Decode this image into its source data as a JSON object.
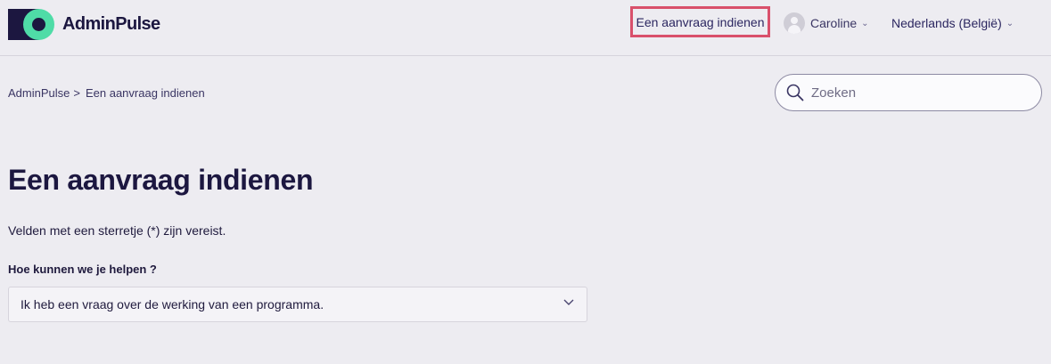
{
  "header": {
    "brand": "AdminPulse",
    "submit_request_link": "Een aanvraag indienen",
    "user_name": "Caroline",
    "language": "Nederlands (België)"
  },
  "breadcrumb": {
    "items": [
      "AdminPulse",
      "Een aanvraag indienen"
    ],
    "separator": ">"
  },
  "search": {
    "placeholder": "Zoeken",
    "value": ""
  },
  "main": {
    "title": "Een aanvraag indienen",
    "required_note": "Velden met een sterretje (*) zijn vereist.",
    "help_field": {
      "label": "Hoe kunnen we je helpen ?",
      "selected": "Ik heb een vraag over de werking van een programma."
    }
  },
  "colors": {
    "background": "#edecf1",
    "brand_dark": "#1c1740",
    "brand_accent": "#4fdca7",
    "highlight_border": "#d9506b"
  },
  "icons": {
    "search": "search-icon",
    "user": "user-avatar-icon",
    "dropdown": "chevron-down-icon"
  }
}
